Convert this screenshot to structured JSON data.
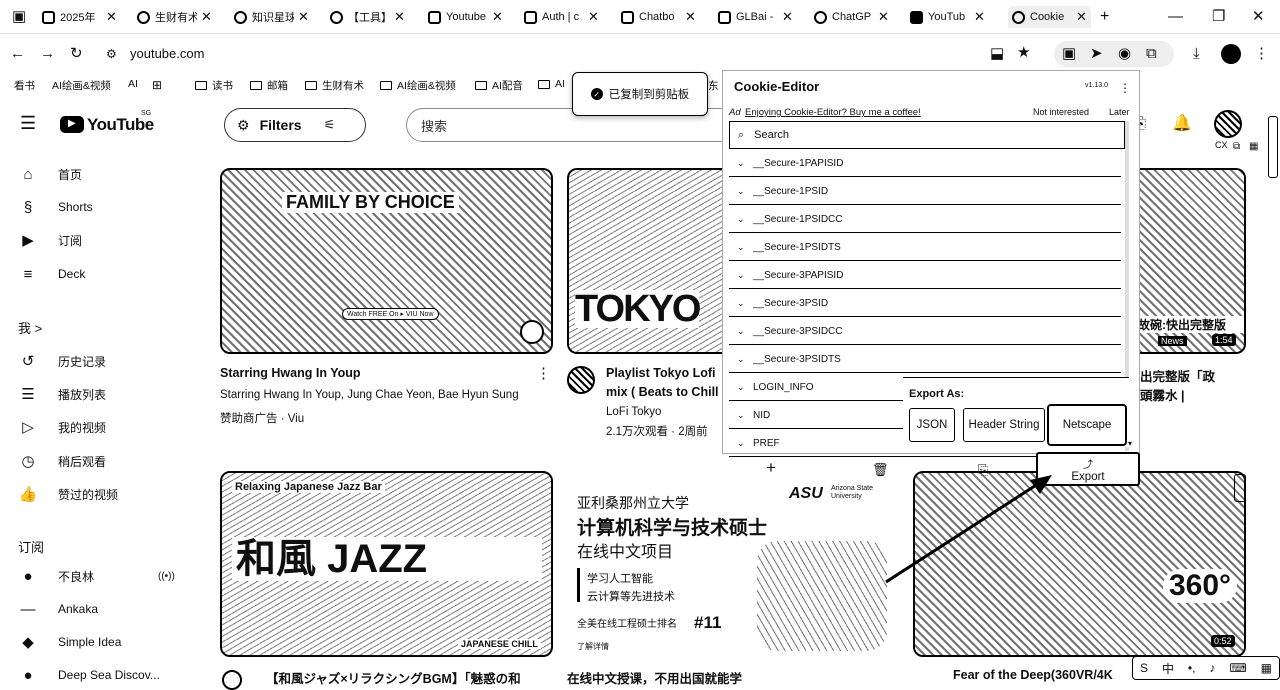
{
  "tabs": [
    {
      "label": "2025年",
      "icon": "doc-icon"
    },
    {
      "label": "生财有术",
      "icon": "loading-icon"
    },
    {
      "label": "知识星球",
      "icon": "loading-icon"
    },
    {
      "label": "【工具】",
      "icon": "loading-icon"
    },
    {
      "label": "Youtube",
      "icon": "bookmark-icon"
    },
    {
      "label": "Auth | c",
      "icon": "auth-icon"
    },
    {
      "label": "Chatbo",
      "icon": "chat-icon"
    },
    {
      "label": "GLBai -",
      "icon": "doc-icon"
    },
    {
      "label": "ChatGP",
      "icon": "openai-icon"
    },
    {
      "label": "YouTub",
      "icon": "youtube-icon"
    },
    {
      "label": "Cookie",
      "icon": "cookie-icon"
    }
  ],
  "address": {
    "url": "youtube.com"
  },
  "bookmarks": [
    "看书",
    "AI绘画&视频",
    "AI",
    "读书",
    "邮箱",
    "生财有术",
    "AI绘画&视频",
    "AI配音",
    "AI",
    "东"
  ],
  "toast": {
    "text": "已复制到剪贴板"
  },
  "youtube": {
    "logo": "YouTube",
    "region": "SG",
    "filters_label": "Filters",
    "search_placeholder": "搜索",
    "sidebar": {
      "main": [
        {
          "label": "首页",
          "icon": "home-icon"
        },
        {
          "label": "Shorts",
          "icon": "shorts-icon"
        },
        {
          "label": "订阅",
          "icon": "subscriptions-icon"
        },
        {
          "label": "Deck",
          "icon": "deck-icon"
        }
      ],
      "you_heading": "我 >",
      "you": [
        {
          "label": "历史记录",
          "icon": "history-icon"
        },
        {
          "label": "播放列表",
          "icon": "playlist-icon"
        },
        {
          "label": "我的视频",
          "icon": "my-videos-icon"
        },
        {
          "label": "稍后观看",
          "icon": "watch-later-icon"
        },
        {
          "label": "赞过的视频",
          "icon": "like-icon"
        }
      ],
      "subs_heading": "订阅",
      "subs": [
        {
          "label": "不良林",
          "icon": "channel-avatar-icon"
        },
        {
          "label": "Ankaka",
          "icon": "channel-avatar-icon"
        },
        {
          "label": "Simple Idea",
          "icon": "channel-avatar-icon"
        },
        {
          "label": "Deep Sea Discov...",
          "icon": "channel-avatar-icon"
        }
      ]
    },
    "videos": [
      {
        "title": "Starring Hwang In Youp",
        "line2": "Starring Hwang In Youp, Jung Chae Yeon, Bae Hyun Sung",
        "line3": "赞助商广告 · Viu",
        "thumb_text": "FAMILY BY CHOICE",
        "thumb_sub": "Watch FREE On ▸ VIU Now"
      },
      {
        "title": "Playlist Tokyo Lofi",
        "line2": "mix ( Beats to Chill",
        "line3": "LoFi Tokyo",
        "line4": "2.1万次观看 · 2周前",
        "thumb_text": "TOKYO"
      },
      {
        "title": "故碗:快出完整版",
        "line2": "出完整版「政",
        "line3": "頭霧水 |",
        "duration": "1:54",
        "badge": "News"
      },
      {
        "title": "【和風ジャズ×リラクシングBGM】「魅惑の和",
        "thumb_text": "和風 JAZZ",
        "thumb_sub": "Relaxing Japanese Jazz Bar",
        "thumb_corner": "JAPANESE CHILL"
      },
      {
        "title": "在线中文授课，不用出国就能学"
      },
      {
        "title": "Fear of the Deep(360VR/4K",
        "duration": "0:52",
        "thumb_text": "360°"
      }
    ],
    "ad": {
      "school": "亚利桑那州立大学",
      "program": "计算机科学与技术硕士",
      "subtitle": "在线中文项目",
      "bullets": [
        "学习人工智能",
        "云计算等先进技术"
      ],
      "ranking": "全美在线工程硕士排名",
      "rank_no": "#11",
      "more": "了解详情",
      "logo": "ASU",
      "logo_sub": "Arizona State University"
    }
  },
  "cookie_editor": {
    "title": "Cookie-Editor",
    "version": "v1.13.0",
    "ad_tag": "Ad",
    "ad_text": "Enjoying Cookie-Editor? Buy me a coffee!",
    "not_interested": "Not interested",
    "later": "Later",
    "search_placeholder": "Search",
    "cookies": [
      "__Secure-1PAPISID",
      "__Secure-1PSID",
      "__Secure-1PSIDCC",
      "__Secure-1PSIDTS",
      "__Secure-3PAPISID",
      "__Secure-3PSID",
      "__Secure-3PSIDCC",
      "__Secure-3PSIDTS",
      "LOGIN_INFO",
      "NID",
      "PREF"
    ],
    "export_as": "Export As:",
    "export_options": [
      "JSON",
      "Header String",
      "Netscape"
    ],
    "export_button": "Export"
  },
  "account": {
    "avatar": "CX"
  }
}
